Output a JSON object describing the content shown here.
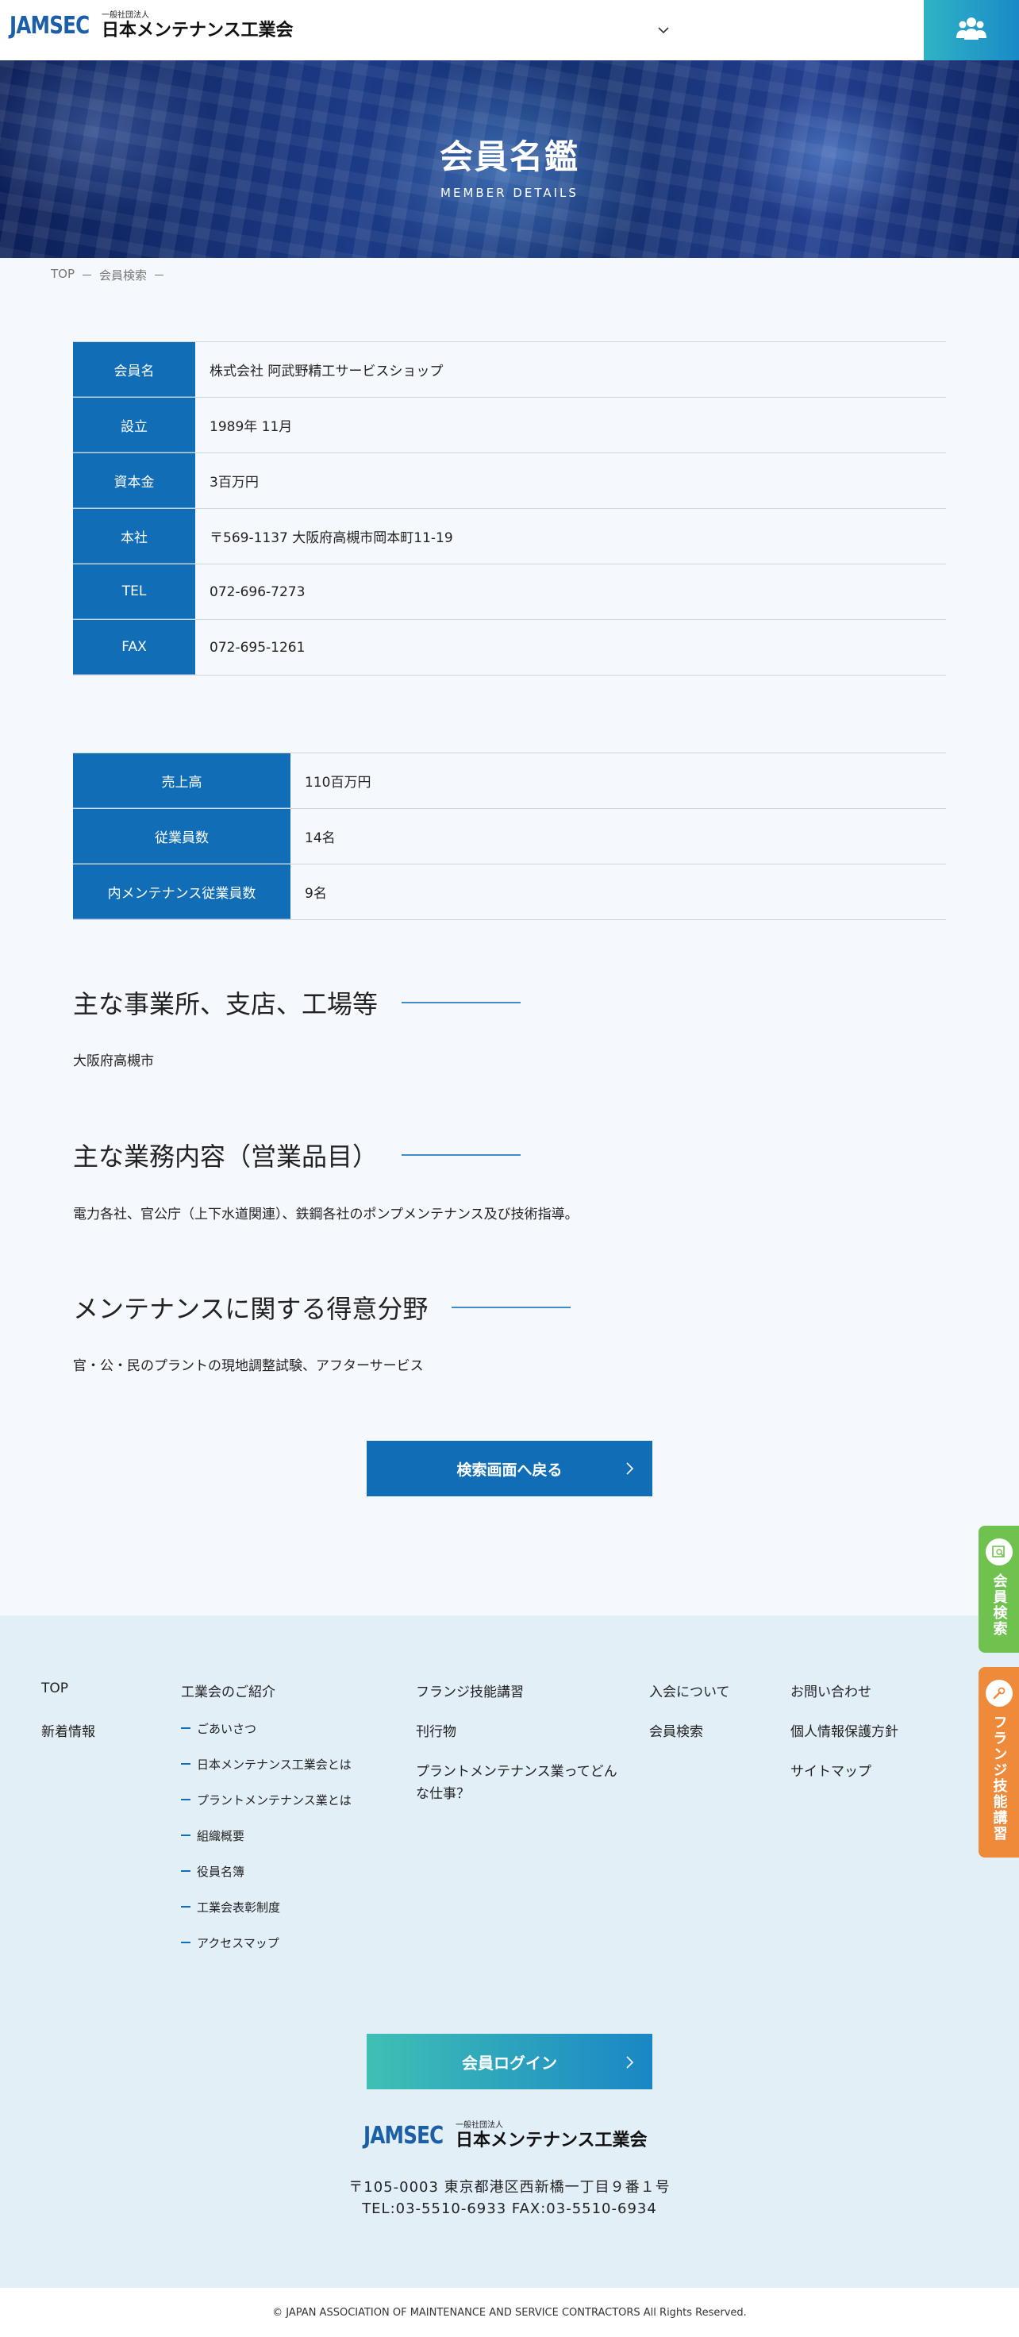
{
  "header": {
    "logo_mark": "JAMSEC",
    "logo_small": "一般社団法人",
    "logo_name": "日本メンテナンス工業会"
  },
  "hero": {
    "title": "会員名鑑",
    "subtitle": "MEMBER DETAILS"
  },
  "breadcrumb": {
    "items": [
      "TOP",
      "－",
      "会員検索",
      "－"
    ]
  },
  "table1": {
    "rows": [
      {
        "label": "会員名",
        "value": "株式会社 阿武野精工サービスショップ"
      },
      {
        "label": "設立",
        "value": "1989年 11月"
      },
      {
        "label": "資本金",
        "value": "3百万円"
      },
      {
        "label": "本社",
        "value": "〒569-1137 大阪府高槻市岡本町11-19"
      },
      {
        "label": "TEL",
        "value": "072-696-7273"
      },
      {
        "label": "FAX",
        "value": "072-695-1261"
      }
    ]
  },
  "table2": {
    "rows": [
      {
        "label": "売上高",
        "value": "110百万円"
      },
      {
        "label": "従業員数",
        "value": "14名"
      },
      {
        "label": "内メンテナンス従業員数",
        "value": "9名"
      }
    ]
  },
  "sections": [
    {
      "title": "主な事業所、支店、工場等",
      "body": "大阪府高槻市"
    },
    {
      "title": "主な業務内容（営業品目）",
      "body": "電力各社、官公庁（上下水道関連）、鉄鋼各社のポンプメンテナンス及び技術指導。"
    },
    {
      "title": "メンテナンスに関する得意分野",
      "body": "官・公・民のプラントの現地調整試験、アフターサービス"
    }
  ],
  "back_button": "検索画面へ戻る",
  "side_tabs": {
    "search": "会員検索",
    "flange": "フランジ技能講習"
  },
  "footer": {
    "col1": [
      "TOP",
      "新着情報"
    ],
    "col2_title": "工業会のご紹介",
    "col2_items": [
      "ごあいさつ",
      "日本メンテナンス工業会とは",
      "プラントメンテナンス業とは",
      "組織概要",
      "役員名簿",
      "工業会表彰制度",
      "アクセスマップ"
    ],
    "col3": [
      "フランジ技能講習",
      "刊行物",
      "プラントメンテナンス業ってどん",
      "な仕事？"
    ],
    "col4": [
      "入会について",
      "会員検索"
    ],
    "col5": [
      "お問い合わせ",
      "個人情報保護方針",
      "サイトマップ"
    ],
    "login_button": "会員ログイン",
    "address": "〒105-0003 東京都港区西新橋一丁目９番１号",
    "tel_fax": "TEL:03-5510-6933 FAX:03-5510-6934"
  },
  "copyright": "© JAPAN ASSOCIATION OF MAINTENANCE AND SERVICE CONTRACTORS All Rights Reserved.",
  "colors": {
    "brand_blue": "#116db6",
    "search_tab": "#70c24f",
    "flange_tab": "#ef8a3a"
  }
}
